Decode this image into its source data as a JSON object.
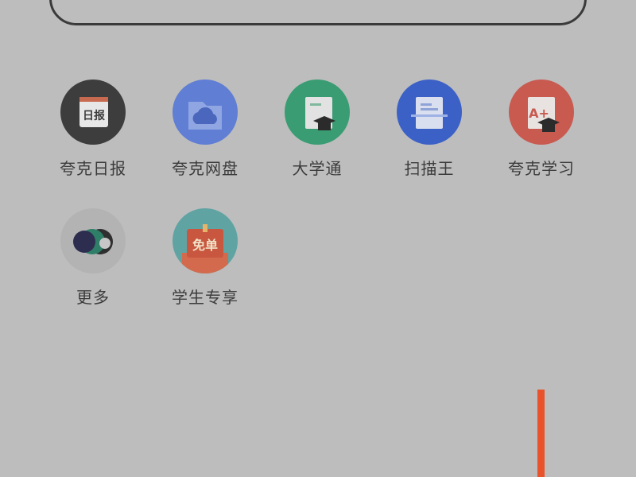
{
  "search": {
    "placeholder": ""
  },
  "apps": [
    {
      "label": "夸克日报",
      "icon": "daily-news-icon",
      "icon_text": "日报",
      "color": "#3d3d3d"
    },
    {
      "label": "夸克网盘",
      "icon": "cloud-drive-icon",
      "color": "#5f7ed4"
    },
    {
      "label": "大学通",
      "icon": "university-icon",
      "color": "#3a9c72"
    },
    {
      "label": "扫描王",
      "icon": "scanner-icon",
      "color": "#3b61c7"
    },
    {
      "label": "夸克学习",
      "icon": "study-icon",
      "icon_text": "A+",
      "color": "#c85a50"
    },
    {
      "label": "更多",
      "icon": "more-icon",
      "color": "#a9a9a9"
    },
    {
      "label": "学生专享",
      "icon": "student-exclusive-icon",
      "icon_text": "免单",
      "color": "#c9563f"
    }
  ],
  "accent_color": "#e9532b"
}
